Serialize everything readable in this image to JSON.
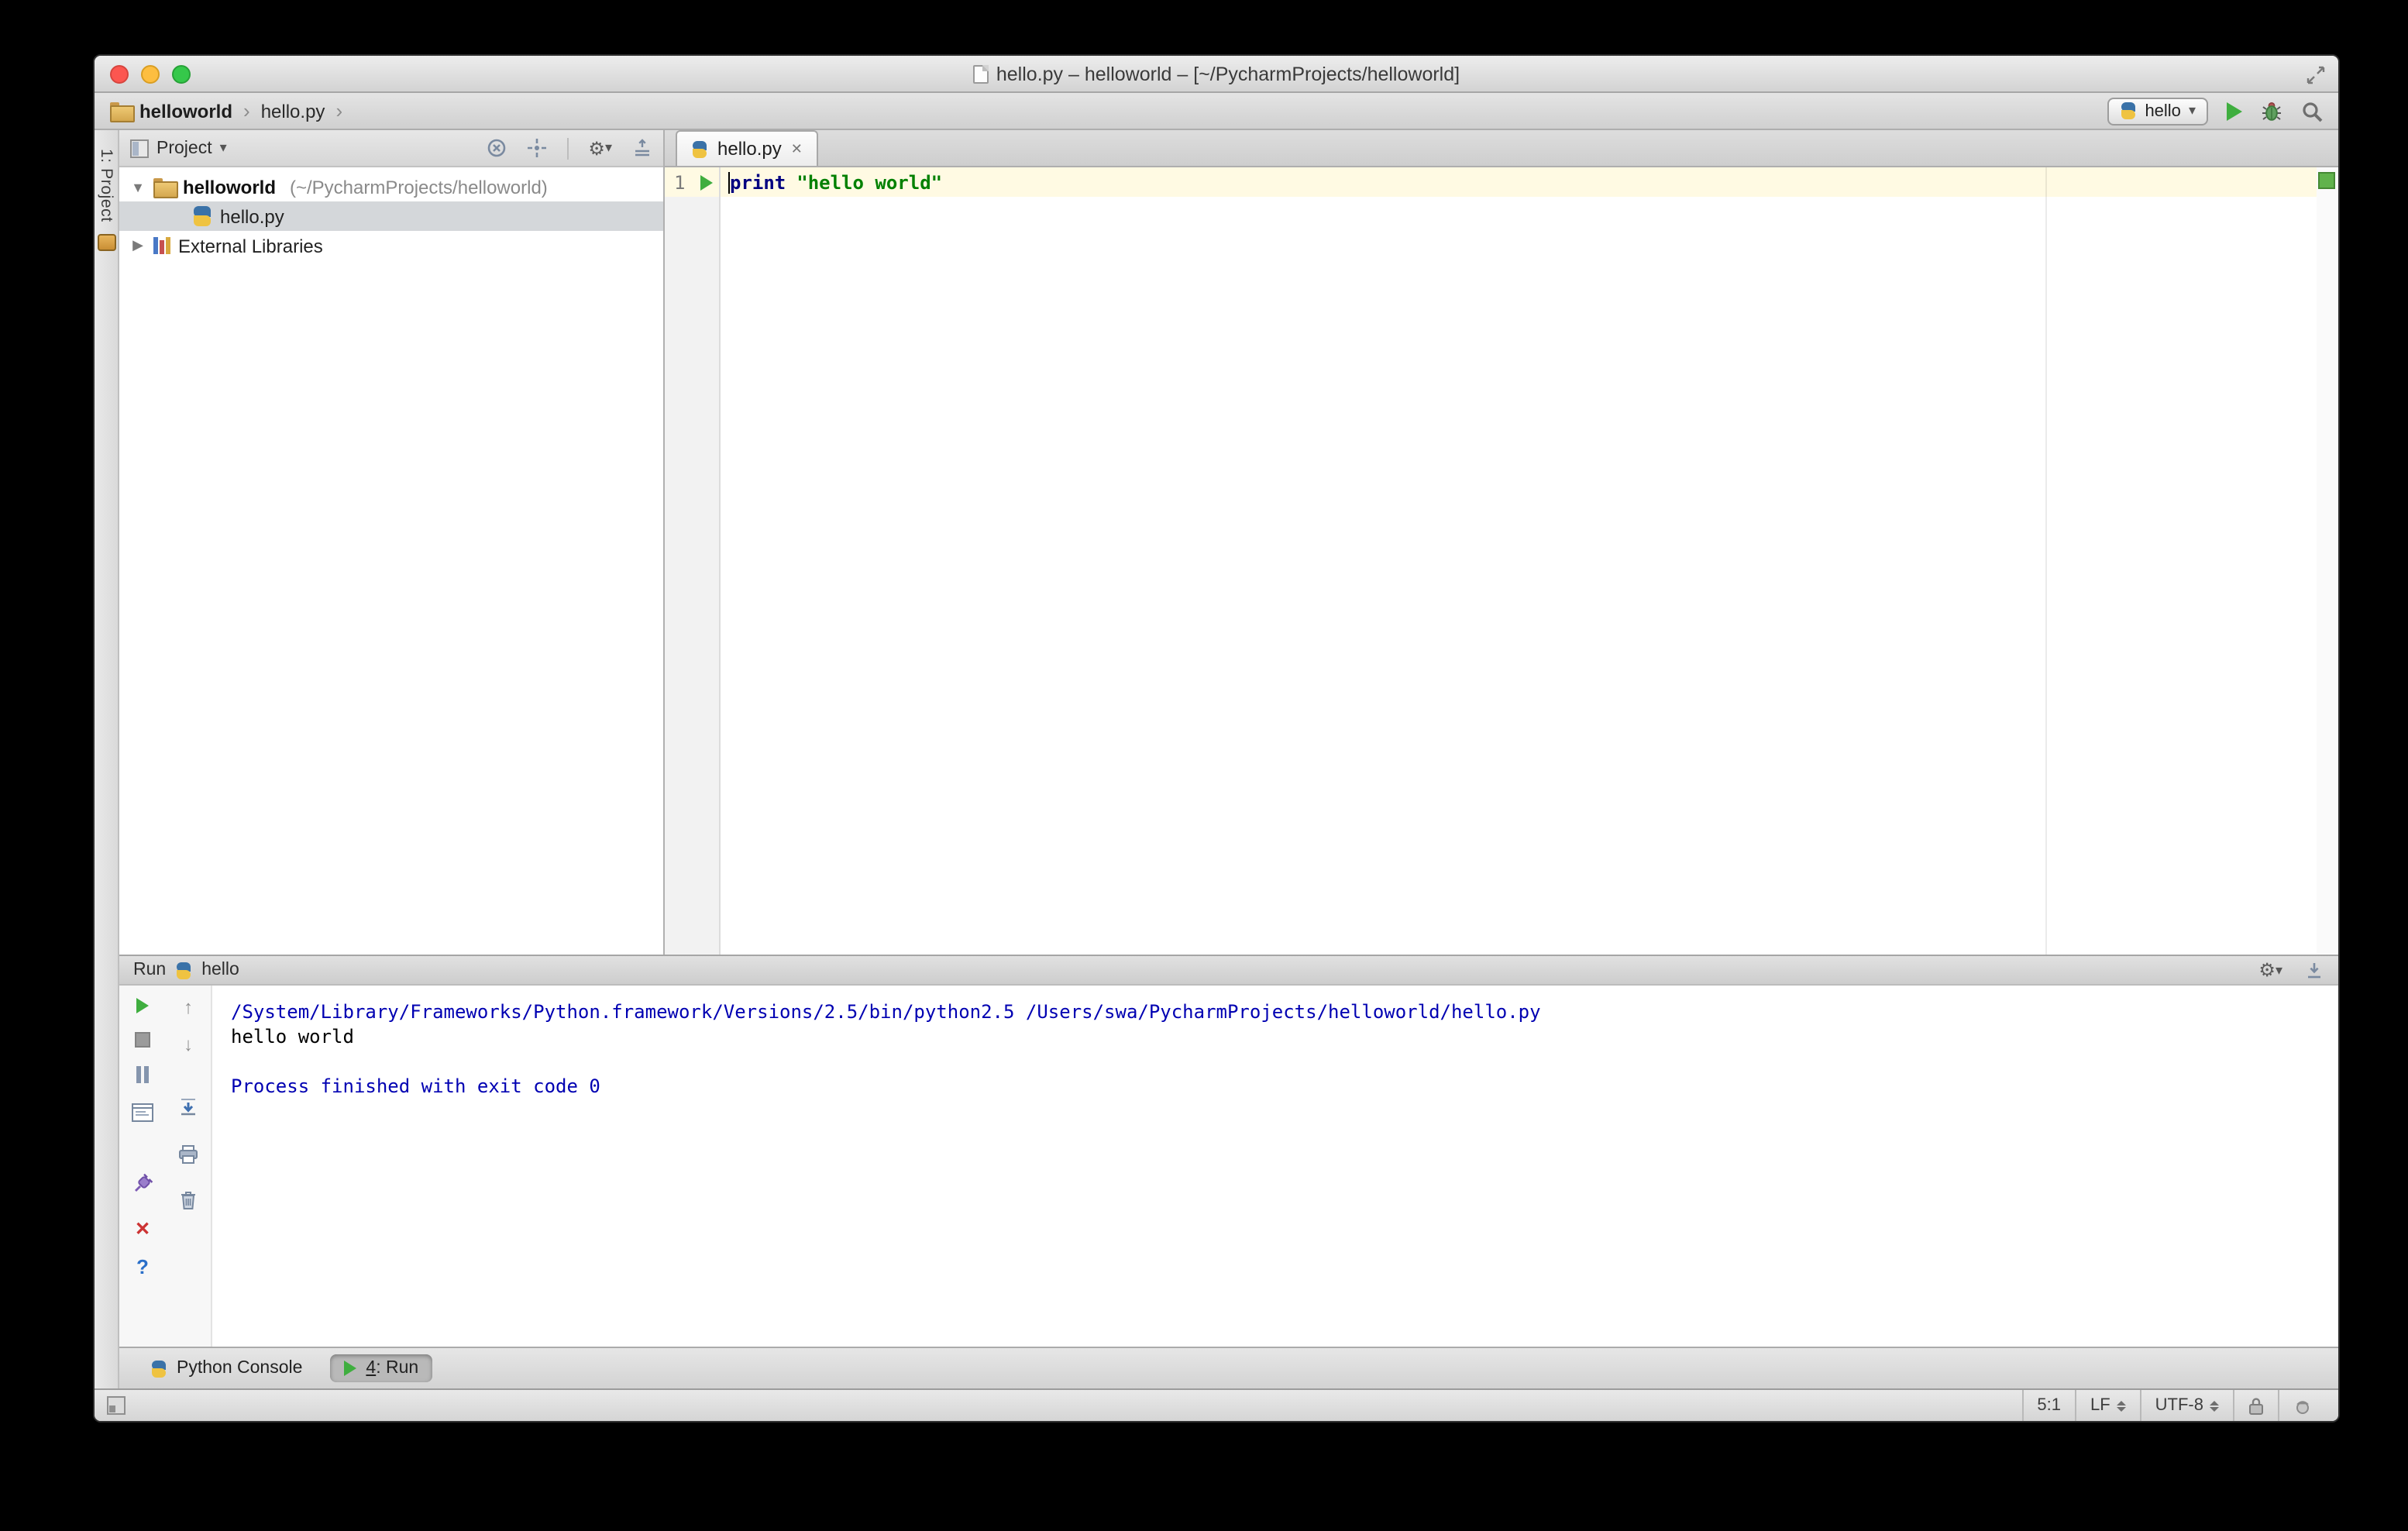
{
  "titlebar": {
    "title": "hello.py – helloworld – [~/PycharmProjects/helloworld]"
  },
  "toolbar": {
    "breadcrumb": [
      "helloworld",
      "hello.py"
    ],
    "run_config": "hello"
  },
  "project": {
    "tab_label": "1: Project",
    "header": "Project",
    "tree": [
      {
        "name": "helloworld",
        "path": "(~/PycharmProjects/helloworld)"
      },
      {
        "name": "hello.py"
      },
      {
        "name": "External Libraries"
      }
    ]
  },
  "editor": {
    "tab": "hello.py",
    "line_number": "1",
    "keyword": "print",
    "string": "\"hello world\""
  },
  "run": {
    "title": "Run",
    "config": "hello",
    "console": [
      {
        "text": "/System/Library/Frameworks/Python.framework/Versions/2.5/bin/python2.5 /Users/swa/PycharmProjects/helloworld/hello.py",
        "color": "blue"
      },
      {
        "text": "hello world",
        "color": "plain"
      },
      {
        "text": "",
        "color": "plain"
      },
      {
        "text": "Process finished with exit code 0",
        "color": "blue"
      }
    ]
  },
  "toolwindows": {
    "python_console": "Python Console",
    "run_number": "4",
    "run_label": ": Run"
  },
  "statusbar": {
    "caret": "5:1",
    "line_sep": "LF",
    "encoding": "UTF-8"
  },
  "icons": {
    "chevron": "›",
    "dropdown": "▾",
    "close_tab": "✕",
    "tree_expanded": "▼",
    "tree_collapsed": "▶",
    "up_arrow": "↑",
    "down_arrow": "↓",
    "gear": "⚙",
    "help": "?",
    "close_x": "✕"
  },
  "colors": {
    "run_green": "#3fae3f",
    "console_blue": "#0000b2",
    "keyword_blue": "#000080",
    "string_green": "#008000",
    "line_highlight": "#fffae3"
  }
}
